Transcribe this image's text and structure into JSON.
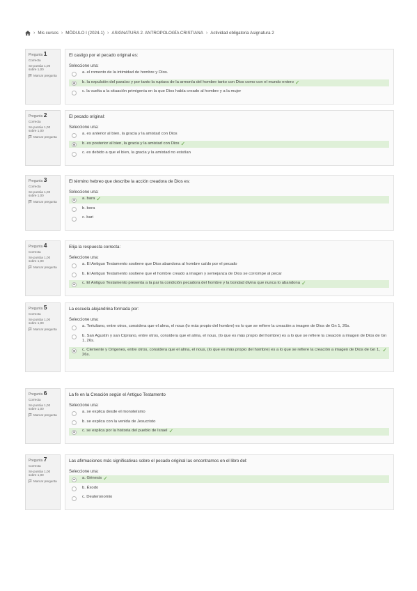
{
  "breadcrumb": {
    "items": [
      "Mis cursos",
      "MÓDULO I (2024-1)",
      "ASIGNATURA 2. ANTROPOLOGÍA CRISTIANA",
      "Actividad obligatoria Asignatura 2"
    ]
  },
  "questions": [
    {
      "label": "Pregunta",
      "number": "1",
      "status": "Correcta",
      "score": "Se puntúa 1,00 sobre 1,00",
      "flag": "Marcar pregunta",
      "text": "El castigo por el pecado original es:",
      "prompt": "Seleccione una:",
      "answers": [
        {
          "text": "a. el romento de la intimidad de hombre y Dios.",
          "correct": false,
          "selected": false
        },
        {
          "text": "b. la expulsión del paraíso y por tanto la ruptura de la armonía del hombre tanto con Dios como con el mundo entero",
          "correct": true,
          "selected": true
        },
        {
          "text": "c. la vuelta a la situación primigenia en la que Dios había creado al hombre y a la mujer",
          "correct": false,
          "selected": false
        }
      ]
    },
    {
      "label": "Pregunta",
      "number": "2",
      "status": "Correcta",
      "score": "Se puntúa 1,00 sobre 1,00",
      "flag": "Marcar pregunta",
      "text": "El pecado original:",
      "prompt": "Seleccione una:",
      "answers": [
        {
          "text": "a. es anterior al bien, la gracia y la amistad con Dios",
          "correct": false,
          "selected": false
        },
        {
          "text": "b. es posterior al bien, la gracia y la amistad con Dios",
          "correct": true,
          "selected": true
        },
        {
          "text": "c. es debido a que el bien, la gracia y la amistad no existían",
          "correct": false,
          "selected": false
        }
      ]
    },
    {
      "label": "Pregunta",
      "number": "3",
      "status": "Correcta",
      "score": "Se puntúa 1,00 sobre 1,00",
      "flag": "Marcar pregunta",
      "text": "El término hebreo que describe la acción creadora de Dios es:",
      "prompt": "Seleccione una:",
      "answers": [
        {
          "text": "a. bara",
          "correct": true,
          "selected": true
        },
        {
          "text": "b. bora",
          "correct": false,
          "selected": false
        },
        {
          "text": "c. bari",
          "correct": false,
          "selected": false
        }
      ]
    },
    {
      "label": "Pregunta",
      "number": "4",
      "status": "Correcta",
      "score": "Se puntúa 1,00 sobre 1,00",
      "flag": "Marcar pregunta",
      "text": "Elija la respuesta correcta:",
      "prompt": "Seleccione una:",
      "answers": [
        {
          "text": "a. El Antiguo Testamento sostiene que Dios abandona al hombre caído por el pecado",
          "correct": false,
          "selected": false
        },
        {
          "text": "b. El Antiguo Testamento sostiene que el hombre creado a imagen y semejanza de Dios se corrompe al pecar",
          "correct": false,
          "selected": false
        },
        {
          "text": "c. El Antiguo Testamento presenta a la par la condición pecadora del hombre y la bondad divina que nunca lo abandona",
          "correct": true,
          "selected": true
        }
      ]
    },
    {
      "label": "Pregunta",
      "number": "5",
      "status": "Correcta",
      "score": "Se puntúa 1,00 sobre 1,00",
      "flag": "Marcar pregunta",
      "text": "La escuela alejandrina formada por:",
      "prompt": "Seleccione una:",
      "answers": [
        {
          "text": "a. Tertuliano, entre otros, considera que el alma, el nous (lo más propio del hombre) es lo que se refiere la creación a imagen de Dios de Gn 1, 26s.",
          "correct": false,
          "selected": false
        },
        {
          "text": "b. San Agustín y san Cipriano, entre otros, considera que el alma, el nous, (lo que es más propio del hombre) es a lo que se refiere la creación a imagen de Dios de Gn 1, 26s.",
          "correct": false,
          "selected": false
        },
        {
          "text": "c. Clemente y Orígenes, entre otros, considera que el alma, el nous, (lo que es más propio del hombre) es a lo que se refiere la creación a imagen de Dios de Gn 1, 26s.",
          "correct": true,
          "selected": true
        }
      ]
    },
    {
      "label": "Pregunta",
      "number": "6",
      "status": "Correcta",
      "score": "Se puntúa 1,00 sobre 1,00",
      "flag": "Marcar pregunta",
      "text": "La fe en la Creación según el Antiguo Testamento",
      "prompt": "Seleccione una:",
      "answers": [
        {
          "text": "a. se explica desde el monoteísmo",
          "correct": false,
          "selected": false
        },
        {
          "text": "b. se explica con la venida de Jesucristo",
          "correct": false,
          "selected": false
        },
        {
          "text": "c. se explica por la historia del pueblo de Israel",
          "correct": true,
          "selected": true
        }
      ]
    },
    {
      "label": "Pregunta",
      "number": "7",
      "status": "Correcta",
      "score": "Se puntúa 1,00 sobre 1,00",
      "flag": "Marcar pregunta",
      "text": "Las afirmaciones más significativas sobre el pecado original las encontramos en el libro del:",
      "prompt": "Seleccione una:",
      "answers": [
        {
          "text": "a. Génesis",
          "correct": true,
          "selected": true
        },
        {
          "text": "b. Éxodo",
          "correct": false,
          "selected": false
        },
        {
          "text": "c. Deuteronomio",
          "correct": false,
          "selected": false
        }
      ]
    }
  ],
  "colors": {
    "correct_bg": "#dff0d8",
    "check": "#5a9e3c",
    "info_bg": "#f2f2f2"
  },
  "icons": {
    "home": "home-icon",
    "separator": "chevron-right-icon",
    "flag": "flag-icon",
    "check": "check-icon"
  }
}
